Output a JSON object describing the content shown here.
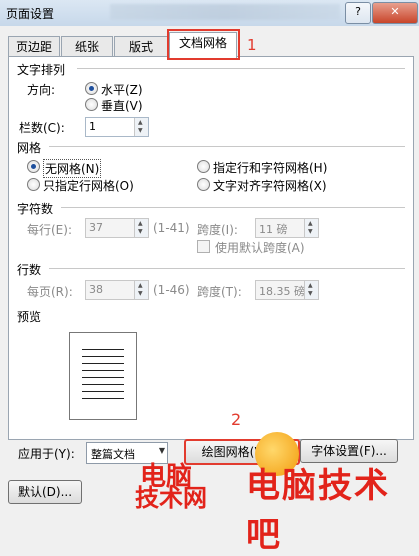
{
  "window": {
    "title": "页面设置"
  },
  "tabs": [
    "页边距",
    "纸张",
    "版式",
    "文档网格"
  ],
  "active_tab": "文档网格",
  "annotations": {
    "one": "1",
    "two": "2"
  },
  "text_direction": {
    "section": "文字排列",
    "direction_label": "方向:",
    "horizontal": "水平(Z)",
    "vertical": "垂直(V)",
    "columns_label": "栏数(C):",
    "columns_value": "1"
  },
  "grid": {
    "section": "网格",
    "no_grid": "无网格(N)",
    "line_only": "只指定行网格(O)",
    "line_and_char": "指定行和字符网格(H)",
    "snap_char": "文字对齐字符网格(X)"
  },
  "chars": {
    "section": "字符数",
    "per_line_label": "每行(E):",
    "per_line_value": "37",
    "per_line_range": "(1-41)",
    "pitch_label": "跨度(I):",
    "pitch_value": "11 磅",
    "use_default": "使用默认跨度(A)"
  },
  "lines": {
    "section": "行数",
    "per_page_label": "每页(R):",
    "per_page_value": "38",
    "per_page_range": "(1-46)",
    "pitch_label": "跨度(T):",
    "pitch_value": "18.35 磅"
  },
  "preview": {
    "section": "预览"
  },
  "apply_to": {
    "label": "应用于(Y):",
    "value": "整篇文档"
  },
  "buttons": {
    "draw_grid": "绘图网格(W)...",
    "font_settings": "字体设置(F)...",
    "default": "默认(D)..."
  },
  "watermark": {
    "line1": "电脑",
    "line2": "技术网",
    "line3": "电脑技术吧"
  },
  "colors": {
    "annotation": "#e23b2e",
    "watermark": "#e2231a",
    "radio_dot": "#1e4f9c"
  }
}
